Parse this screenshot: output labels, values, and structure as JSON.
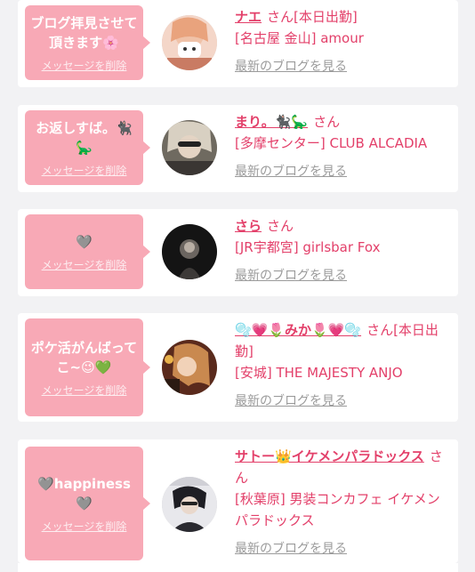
{
  "cards": [
    {
      "message": "ブログ拝見させて頂きます🌸",
      "delete_label": "メッセージを削除",
      "name": "ナエ",
      "suffix": "さん[本日出勤]",
      "shop": "[名古屋 金山] amour",
      "blog_link": "最新のブログを見る"
    },
    {
      "message": "お返しすば。🐈‍⬛🦕",
      "delete_label": "メッセージを削除",
      "name": "まり。🐈‍⬛🦕",
      "suffix": "さん",
      "shop": "[多摩センター] CLUB ALCADIA",
      "blog_link": "最新のブログを見る"
    },
    {
      "message": "🩶",
      "delete_label": "メッセージを削除",
      "name": "さら",
      "suffix": "さん",
      "shop": "[JR宇都宮] girlsbar Fox",
      "blog_link": "最新のブログを見る"
    },
    {
      "message": "ポケ活がんばってこ~😉💚",
      "delete_label": "メッセージを削除",
      "name": "🫧💗🌷みか🌷💗🫧",
      "suffix": "さん[本日出勤]",
      "shop": "[安城] THE MAJESTY ANJO",
      "blog_link": "最新のブログを見る"
    },
    {
      "message": "🩶happiness🩶",
      "delete_label": "メッセージを削除",
      "name": "サトー👑イケメンパラドックス",
      "suffix": "さん",
      "shop": "[秋葉原] 男装コンカフェ イケメンパラドックス",
      "blog_link": "最新のブログを見る"
    }
  ],
  "colors": {
    "bubble": "#f8a9b6",
    "accent": "#e3406a",
    "muted": "#9b9b9b"
  },
  "avatar_icons": [
    "avatar-photo-1",
    "avatar-photo-2",
    "avatar-photo-3",
    "avatar-photo-4",
    "avatar-photo-5"
  ]
}
